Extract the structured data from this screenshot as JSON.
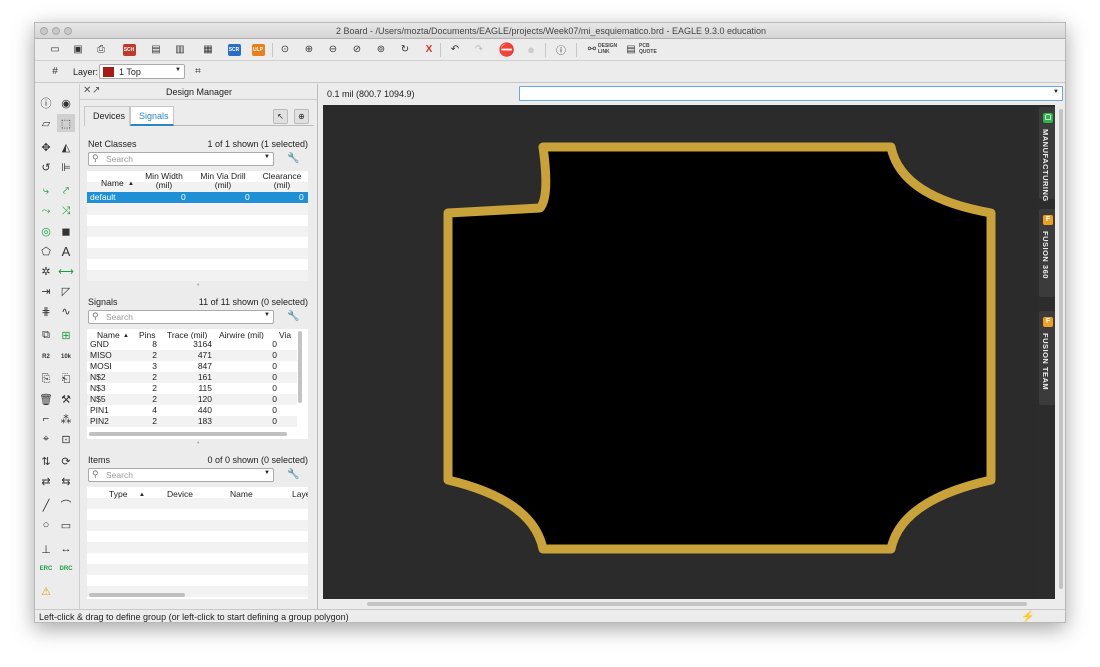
{
  "window": {
    "title": "2 Board - /Users/mozta/Documents/EAGLE/projects/Week07/mi_esquiematico.brd - EAGLE 9.3.0 education"
  },
  "toolbar": {
    "sch_label": "SCH",
    "scr_label": "SCR",
    "ulp_label": "ULP",
    "undo_redo_x": "X",
    "design_link": [
      "DESIGN",
      "LINK"
    ],
    "pcb_quote": [
      "PCB",
      "QUOTE"
    ]
  },
  "layer": {
    "label": "Layer:",
    "value": "1 Top",
    "color": "#a71a16"
  },
  "design_manager": {
    "title": "Design Manager",
    "tabs": [
      "Devices",
      "Signals"
    ],
    "active_tab": "Signals",
    "net_classes": {
      "title": "Net Classes",
      "count": "1 of 1 shown (1 selected)",
      "search_placeholder": "Search",
      "columns": [
        "Name",
        "Min Width\n(mil)",
        "Min Via Drill\n(mil)",
        "Clearance\n(mil)"
      ],
      "rows": [
        {
          "name": "default",
          "min_width": "0",
          "min_via_drill": "0",
          "clearance": "0"
        }
      ]
    },
    "signals": {
      "title": "Signals",
      "count": "11 of 11 shown (0 selected)",
      "search_placeholder": "Search",
      "columns": [
        "Name",
        "Pins",
        "Trace (mil)",
        "Airwire (mil)",
        "Via"
      ],
      "rows": [
        {
          "name": "GND",
          "pins": "8",
          "trace": "3164",
          "airwire": "0"
        },
        {
          "name": "MISO",
          "pins": "2",
          "trace": "471",
          "airwire": "0"
        },
        {
          "name": "MOSI",
          "pins": "3",
          "trace": "847",
          "airwire": "0"
        },
        {
          "name": "N$2",
          "pins": "2",
          "trace": "161",
          "airwire": "0"
        },
        {
          "name": "N$3",
          "pins": "2",
          "trace": "115",
          "airwire": "0"
        },
        {
          "name": "N$5",
          "pins": "2",
          "trace": "120",
          "airwire": "0"
        },
        {
          "name": "PIN1",
          "pins": "4",
          "trace": "440",
          "airwire": "0"
        },
        {
          "name": "PIN2",
          "pins": "2",
          "trace": "183",
          "airwire": "0"
        }
      ]
    },
    "items": {
      "title": "Items",
      "count": "0 of 0 shown (0 selected)",
      "search_placeholder": "Search",
      "columns": [
        "Type",
        "Device",
        "Name",
        "Laye"
      ]
    }
  },
  "coordinates": {
    "text": "0.1 mil (800.7 1094.9)"
  },
  "command_input": {
    "value": ""
  },
  "side_panels": [
    {
      "label": "MANUFACTURING",
      "badge_color": "#2fb34a",
      "badge": "▢"
    },
    {
      "label": "FUSION 360",
      "badge_color": "#f0a020",
      "badge": "F"
    },
    {
      "label": "FUSION TEAM",
      "badge_color": "#f0a020",
      "badge": "F"
    }
  ],
  "board": {
    "outline_color": "#c9a23a",
    "fill_color": "#000000"
  },
  "status": {
    "text": "Left-click & drag to define group (or left-click to start defining a group polygon)"
  },
  "left_tools": {
    "text_tool": "A",
    "r2_label": "R2",
    "r10k_label": "10k",
    "erc_label": "ERC",
    "drc_label": "DRC"
  }
}
